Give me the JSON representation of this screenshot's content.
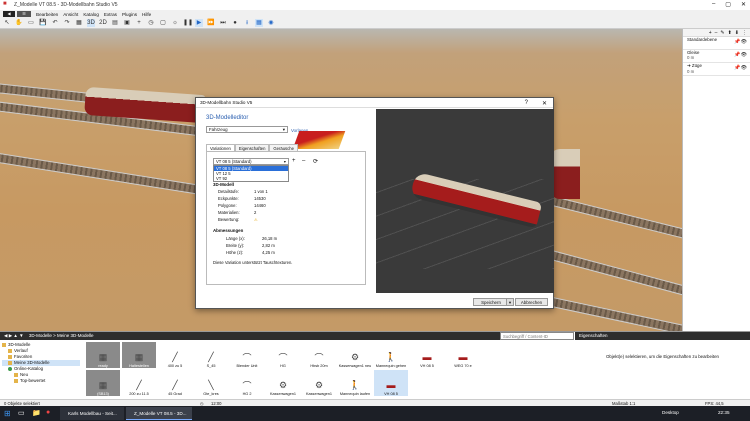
{
  "window": {
    "title": "Z_Modelle VT 08.5 - 3D-Modellbahn Studio V5"
  },
  "menu": [
    "Bearbeiten",
    "Ansicht",
    "Katalog",
    "Extras",
    "Plugins",
    "Hilfe"
  ],
  "right_panel": {
    "layers": [
      {
        "name": "Standardebene",
        "sub": ""
      },
      {
        "name": "Gleise",
        "sub": "0 m"
      },
      {
        "name": "Züge",
        "sub": "0 m"
      }
    ]
  },
  "dialog": {
    "title": "3D-Modellbahn Studio V5",
    "heading": "3D-Modelleditor",
    "category_value": "Fahrzeug",
    "templates_link": "Vorlagen",
    "tabs": [
      "Variationen",
      "Eigenschaften",
      "Geräusche"
    ],
    "variation_value": "VT 08 5 (Standard)",
    "variation_options": [
      "VT 08 5 (Standard)",
      "VT 12 5",
      "VT 92"
    ],
    "section_model": "3D-Modell",
    "detail_label": "Detailstufe:",
    "detail_value": "1 von 1",
    "vertices_label": "Eckpunkte:",
    "vertices_value": "14530",
    "polygons_label": "Polygone:",
    "polygons_value": "14460",
    "materials_label": "Materialien:",
    "materials_value": "2",
    "rating_label": "Bewertung:",
    "section_dims": "Abmessungen",
    "length_label": "Länge (x):",
    "length_value": "26,18 m",
    "width_label": "Breite (y):",
    "width_value": "2,82 m",
    "height_label": "Höhe (z):",
    "height_value": "4,25 m",
    "note": "Diese Variation unterstützt Tauschtexturen.",
    "save_label": "Speichern",
    "cancel_label": "Abbrechen"
  },
  "bottom": {
    "breadcrumb": "3D-Modelle  >  Meine 3D-Modelle",
    "search_placeholder": "Suchbegriff / Content-ID",
    "properties_title": "Eigenschaften",
    "properties_hint": "Objekt(e) selektieren, um die Eigenschaften zu bearbeiten",
    "tree": [
      "3D-Modelle",
      "Verlauf",
      "Favoriten",
      "Meine 3D-Modelle",
      "Online-Katalog",
      "Neu",
      "Top-bewertet"
    ],
    "thumbs_top": [
      "ready",
      "Haltestellen",
      "400 zu 5",
      "S_45",
      "Blender Unit",
      "HG",
      "Hbsb 20m",
      "Kasserwagen1 neu",
      "Mannequin gehen",
      "VH 08 5",
      "WEG 70 e"
    ],
    "thumbs_bottom": [
      "(SB13)",
      "200 zu 11.5",
      "45 Grad",
      "Gte_kres",
      "HG 2",
      "Kassenwagen1",
      "Kassenwagen1",
      "Mannequin laufen",
      "VH 08 5"
    ]
  },
  "status": {
    "left": "0 Objekte selektiert",
    "time": "12:00",
    "scale": "Maßstab 1:1",
    "fps": "FPS: 44,5"
  },
  "taskbar": {
    "items": [
      "Karls Modellbau - Seit...",
      "Z_Modelle VT 08.5 - 3D..."
    ],
    "desktop": "Desktop",
    "clock": "22:35"
  }
}
